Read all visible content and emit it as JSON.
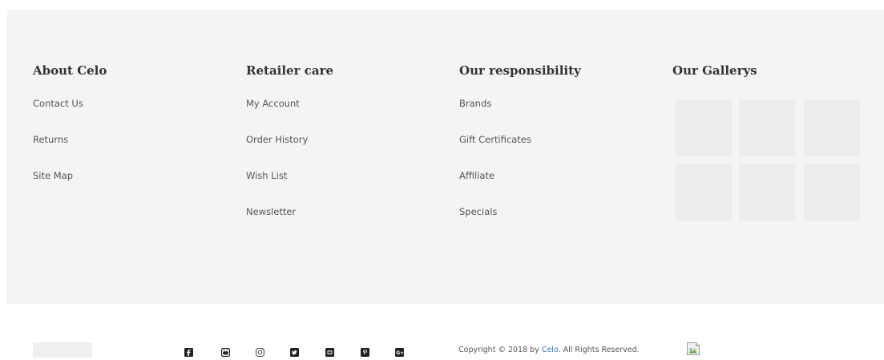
{
  "footer": {
    "columns": [
      {
        "title": "About Celo",
        "links": [
          "Contact Us",
          "Returns",
          "Site Map"
        ]
      },
      {
        "title": "Retailer care",
        "links": [
          "My Account",
          "Order History",
          "Wish List",
          "Newsletter"
        ]
      },
      {
        "title": "Our responsibility",
        "links": [
          "Brands",
          "Gift Certificates",
          "Affiliate",
          "Specials"
        ]
      },
      {
        "title": "Our Gallerys",
        "gallery_count": 6
      }
    ]
  },
  "bottom": {
    "social_icons": [
      "facebook-icon",
      "youtube-icon",
      "instagram-icon",
      "twitter-icon",
      "vimeo-icon",
      "pinterest-icon",
      "google-plus-icon"
    ],
    "copyright_prefix": "Copyright © 2018 by ",
    "copyright_brand": "Celo",
    "copyright_suffix": ". All Rights Reserved."
  },
  "colors": {
    "footer_bg": "#f4f4f4",
    "link": "#555555",
    "brand_link": "#3b6fb6",
    "gallery_tile": "#ececec"
  }
}
